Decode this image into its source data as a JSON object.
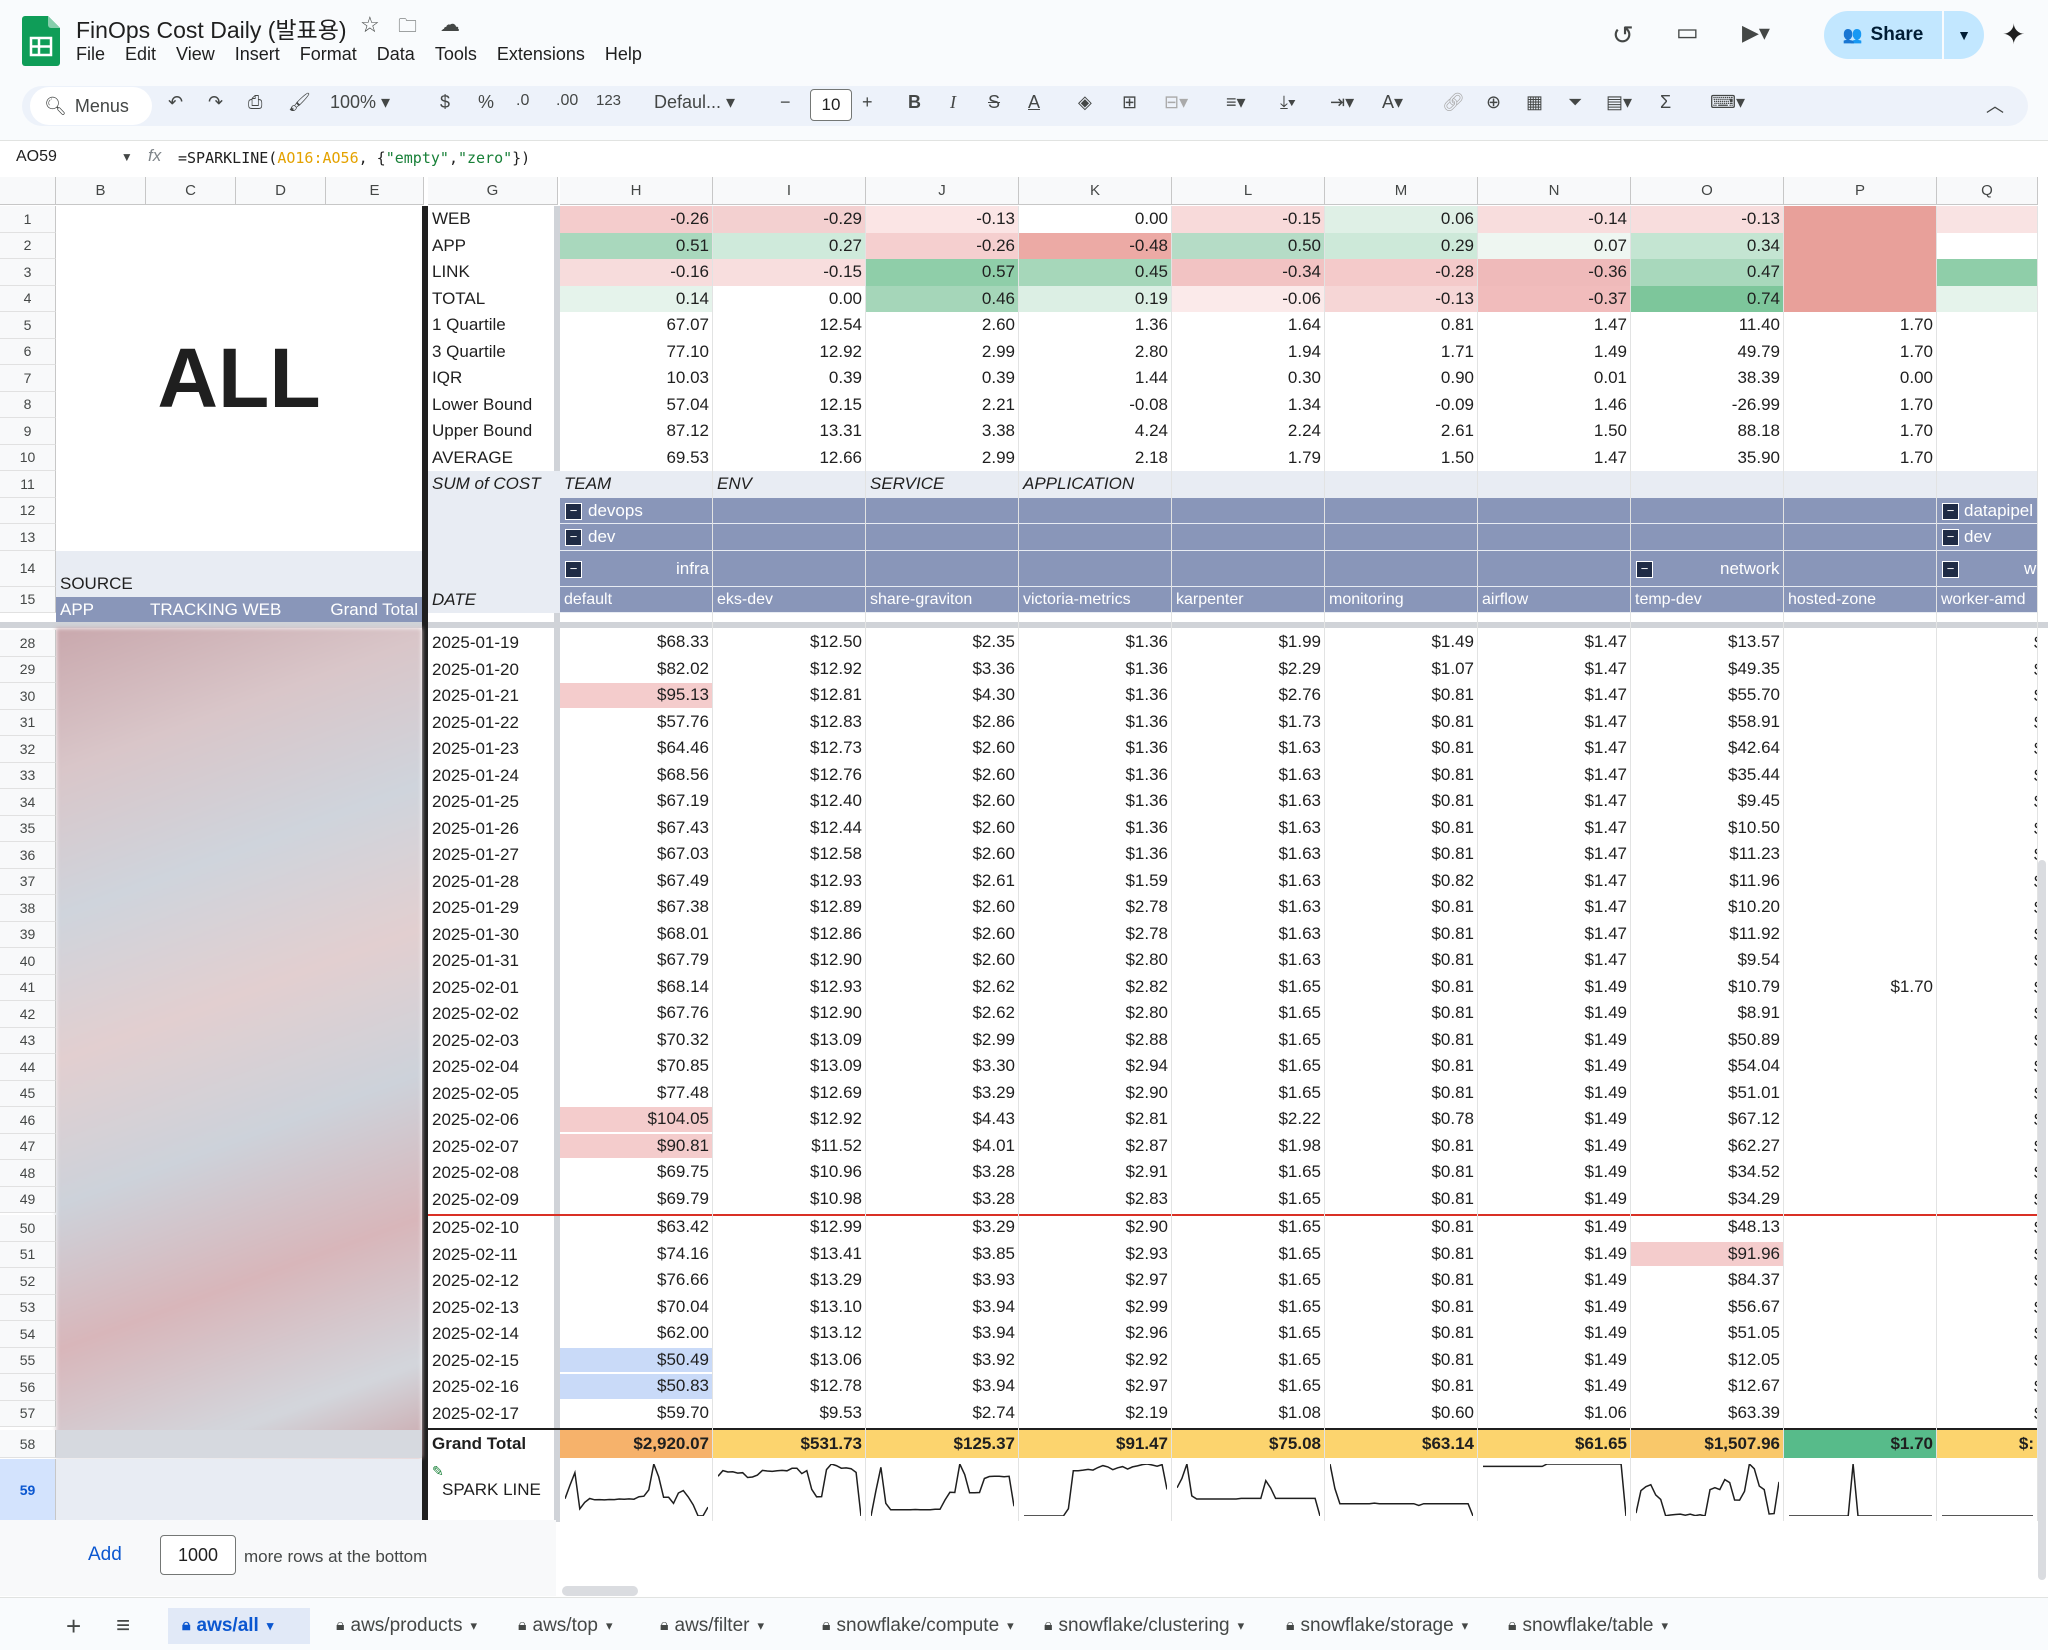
{
  "app": {
    "title": "FinOps Cost Daily (발표용)",
    "share_label": "Share"
  },
  "menu": [
    "File",
    "Edit",
    "View",
    "Insert",
    "Format",
    "Data",
    "Tools",
    "Extensions",
    "Help"
  ],
  "toolbar": {
    "search": "Menus",
    "zoom": "100%",
    "currency": "$",
    "percent": "%",
    "dec_minus": ".0",
    "dec_plus": ".00",
    "format_123": "123",
    "font": "Defaul...",
    "font_size": "10"
  },
  "formula": {
    "cell_ref": "AO59",
    "fx": "fx",
    "prefix": "=SPARKLINE(",
    "range": "AO16:AO56",
    "mid": ", {",
    "s1": "\"empty\"",
    "comma": ",",
    "s2": "\"zero\"",
    "suffix": "})"
  },
  "columns": [
    "B",
    "C",
    "D",
    "E",
    "G",
    "H",
    "I",
    "J",
    "K",
    "L",
    "M",
    "N",
    "O",
    "P",
    "Q"
  ],
  "left_panel": {
    "big_label": "ALL",
    "source": "SOURCE",
    "app": "APP",
    "tracking": "TRACKING WEB",
    "grand_total": "Grand Total"
  },
  "summary_labels": [
    "WEB",
    "APP",
    "LINK",
    "TOTAL",
    "1 Quartile",
    "3 Quartile",
    "IQR",
    "Lower Bound",
    "Upper Bound",
    "AVERAGE"
  ],
  "summary_values": [
    [
      "-0.26",
      "-0.29",
      "-0.13",
      "0.00",
      "-0.15",
      "0.06",
      "-0.14",
      "-0.13",
      ""
    ],
    [
      "0.51",
      "0.27",
      "-0.26",
      "-0.48",
      "0.50",
      "0.29",
      "0.07",
      "0.34",
      ""
    ],
    [
      "-0.16",
      "-0.15",
      "0.57",
      "0.45",
      "-0.34",
      "-0.28",
      "-0.36",
      "0.47",
      ""
    ],
    [
      "0.14",
      "0.00",
      "0.46",
      "0.19",
      "-0.06",
      "-0.13",
      "-0.37",
      "0.74",
      ""
    ],
    [
      "67.07",
      "12.54",
      "2.60",
      "1.36",
      "1.64",
      "0.81",
      "1.47",
      "11.40",
      "1.70"
    ],
    [
      "77.10",
      "12.92",
      "2.99",
      "2.80",
      "1.94",
      "1.71",
      "1.49",
      "49.79",
      "1.70"
    ],
    [
      "10.03",
      "0.39",
      "0.39",
      "1.44",
      "0.30",
      "0.90",
      "0.01",
      "38.39",
      "0.00"
    ],
    [
      "57.04",
      "12.15",
      "2.21",
      "-0.08",
      "1.34",
      "-0.09",
      "1.46",
      "-26.99",
      "1.70"
    ],
    [
      "87.12",
      "13.31",
      "3.38",
      "4.24",
      "2.24",
      "2.61",
      "1.50",
      "88.18",
      "1.70"
    ],
    [
      "69.53",
      "12.66",
      "2.99",
      "2.18",
      "1.79",
      "1.50",
      "1.47",
      "35.90",
      "1.70"
    ]
  ],
  "pivot": {
    "sum_of_cost": "SUM of COST",
    "team": "TEAM",
    "env": "ENV",
    "service": "SERVICE",
    "application": "APPLICATION",
    "devops": "devops",
    "dev": "dev",
    "infra": "infra",
    "network": "network",
    "datapipel": "datapipel",
    "dev2": "dev",
    "w": "w",
    "date": "DATE",
    "apps": [
      "default",
      "eks-dev",
      "share-graviton",
      "victoria-metrics",
      "karpenter",
      "monitoring",
      "airflow",
      "temp-dev",
      "hosted-zone",
      "worker-amd"
    ]
  },
  "rows": [
    {
      "n": "28",
      "d": "2025-01-19",
      "v": [
        "$68.33",
        "$12.50",
        "$2.35",
        "$1.36",
        "$1.99",
        "$1.49",
        "$1.47",
        "$13.57",
        ""
      ]
    },
    {
      "n": "29",
      "d": "2025-01-20",
      "v": [
        "$82.02",
        "$12.92",
        "$3.36",
        "$1.36",
        "$2.29",
        "$1.07",
        "$1.47",
        "$49.35",
        ""
      ]
    },
    {
      "n": "30",
      "d": "2025-01-21",
      "v": [
        "$95.13",
        "$12.81",
        "$4.30",
        "$1.36",
        "$2.76",
        "$0.81",
        "$1.47",
        "$55.70",
        ""
      ]
    },
    {
      "n": "31",
      "d": "2025-01-22",
      "v": [
        "$57.76",
        "$12.83",
        "$2.86",
        "$1.36",
        "$1.73",
        "$0.81",
        "$1.47",
        "$58.91",
        ""
      ]
    },
    {
      "n": "32",
      "d": "2025-01-23",
      "v": [
        "$64.46",
        "$12.73",
        "$2.60",
        "$1.36",
        "$1.63",
        "$0.81",
        "$1.47",
        "$42.64",
        ""
      ]
    },
    {
      "n": "33",
      "d": "2025-01-24",
      "v": [
        "$68.56",
        "$12.76",
        "$2.60",
        "$1.36",
        "$1.63",
        "$0.81",
        "$1.47",
        "$35.44",
        ""
      ]
    },
    {
      "n": "34",
      "d": "2025-01-25",
      "v": [
        "$67.19",
        "$12.40",
        "$2.60",
        "$1.36",
        "$1.63",
        "$0.81",
        "$1.47",
        "$9.45",
        ""
      ]
    },
    {
      "n": "35",
      "d": "2025-01-26",
      "v": [
        "$67.43",
        "$12.44",
        "$2.60",
        "$1.36",
        "$1.63",
        "$0.81",
        "$1.47",
        "$10.50",
        ""
      ]
    },
    {
      "n": "36",
      "d": "2025-01-27",
      "v": [
        "$67.03",
        "$12.58",
        "$2.60",
        "$1.36",
        "$1.63",
        "$0.81",
        "$1.47",
        "$11.23",
        ""
      ]
    },
    {
      "n": "37",
      "d": "2025-01-28",
      "v": [
        "$67.49",
        "$12.93",
        "$2.61",
        "$1.59",
        "$1.63",
        "$0.82",
        "$1.47",
        "$11.96",
        ""
      ]
    },
    {
      "n": "38",
      "d": "2025-01-29",
      "v": [
        "$67.38",
        "$12.89",
        "$2.60",
        "$2.78",
        "$1.63",
        "$0.81",
        "$1.47",
        "$10.20",
        ""
      ]
    },
    {
      "n": "39",
      "d": "2025-01-30",
      "v": [
        "$68.01",
        "$12.86",
        "$2.60",
        "$2.78",
        "$1.63",
        "$0.81",
        "$1.47",
        "$11.92",
        ""
      ]
    },
    {
      "n": "40",
      "d": "2025-01-31",
      "v": [
        "$67.79",
        "$12.90",
        "$2.60",
        "$2.80",
        "$1.63",
        "$0.81",
        "$1.47",
        "$9.54",
        ""
      ]
    },
    {
      "n": "41",
      "d": "2025-02-01",
      "v": [
        "$68.14",
        "$12.93",
        "$2.62",
        "$2.82",
        "$1.65",
        "$0.81",
        "$1.49",
        "$10.79",
        "$1.70"
      ]
    },
    {
      "n": "42",
      "d": "2025-02-02",
      "v": [
        "$67.76",
        "$12.90",
        "$2.62",
        "$2.80",
        "$1.65",
        "$0.81",
        "$1.49",
        "$8.91",
        ""
      ]
    },
    {
      "n": "43",
      "d": "2025-02-03",
      "v": [
        "$70.32",
        "$13.09",
        "$2.99",
        "$2.88",
        "$1.65",
        "$0.81",
        "$1.49",
        "$50.89",
        ""
      ]
    },
    {
      "n": "44",
      "d": "2025-02-04",
      "v": [
        "$70.85",
        "$13.09",
        "$3.30",
        "$2.94",
        "$1.65",
        "$0.81",
        "$1.49",
        "$54.04",
        ""
      ]
    },
    {
      "n": "45",
      "d": "2025-02-05",
      "v": [
        "$77.48",
        "$12.69",
        "$3.29",
        "$2.90",
        "$1.65",
        "$0.81",
        "$1.49",
        "$51.01",
        ""
      ]
    },
    {
      "n": "46",
      "d": "2025-02-06",
      "v": [
        "$104.05",
        "$12.92",
        "$4.43",
        "$2.81",
        "$2.22",
        "$0.78",
        "$1.49",
        "$67.12",
        ""
      ]
    },
    {
      "n": "47",
      "d": "2025-02-07",
      "v": [
        "$90.81",
        "$11.52",
        "$4.01",
        "$2.87",
        "$1.98",
        "$0.81",
        "$1.49",
        "$62.27",
        ""
      ]
    },
    {
      "n": "48",
      "d": "2025-02-08",
      "v": [
        "$69.75",
        "$10.96",
        "$3.28",
        "$2.91",
        "$1.65",
        "$0.81",
        "$1.49",
        "$34.52",
        ""
      ]
    },
    {
      "n": "49",
      "d": "2025-02-09",
      "v": [
        "$69.79",
        "$10.98",
        "$3.28",
        "$2.83",
        "$1.65",
        "$0.81",
        "$1.49",
        "$34.29",
        ""
      ]
    },
    {
      "n": "50",
      "d": "2025-02-10",
      "v": [
        "$63.42",
        "$12.99",
        "$3.29",
        "$2.90",
        "$1.65",
        "$0.81",
        "$1.49",
        "$48.13",
        ""
      ]
    },
    {
      "n": "51",
      "d": "2025-02-11",
      "v": [
        "$74.16",
        "$13.41",
        "$3.85",
        "$2.93",
        "$1.65",
        "$0.81",
        "$1.49",
        "$91.96",
        ""
      ]
    },
    {
      "n": "52",
      "d": "2025-02-12",
      "v": [
        "$76.66",
        "$13.29",
        "$3.93",
        "$2.97",
        "$1.65",
        "$0.81",
        "$1.49",
        "$84.37",
        ""
      ]
    },
    {
      "n": "53",
      "d": "2025-02-13",
      "v": [
        "$70.04",
        "$13.10",
        "$3.94",
        "$2.99",
        "$1.65",
        "$0.81",
        "$1.49",
        "$56.67",
        ""
      ]
    },
    {
      "n": "54",
      "d": "2025-02-14",
      "v": [
        "$62.00",
        "$13.12",
        "$3.94",
        "$2.96",
        "$1.65",
        "$0.81",
        "$1.49",
        "$51.05",
        ""
      ]
    },
    {
      "n": "55",
      "d": "2025-02-15",
      "v": [
        "$50.49",
        "$13.06",
        "$3.92",
        "$2.92",
        "$1.65",
        "$0.81",
        "$1.49",
        "$12.05",
        ""
      ]
    },
    {
      "n": "56",
      "d": "2025-02-16",
      "v": [
        "$50.83",
        "$12.78",
        "$3.94",
        "$2.97",
        "$1.65",
        "$0.81",
        "$1.49",
        "$12.67",
        ""
      ]
    },
    {
      "n": "57",
      "d": "2025-02-17",
      "v": [
        "$59.70",
        "$9.53",
        "$2.74",
        "$2.19",
        "$1.08",
        "$0.60",
        "$1.06",
        "$63.39",
        ""
      ]
    }
  ],
  "grand_total": {
    "label": "Grand Total",
    "n": "58",
    "v": [
      "$2,920.07",
      "$531.73",
      "$125.37",
      "$91.47",
      "$75.08",
      "$63.14",
      "$61.65",
      "$1,507.96",
      "$1.70",
      "$:"
    ]
  },
  "sparkline": {
    "label": "SPARK LINE",
    "n": "59"
  },
  "add_rows": {
    "add": "Add",
    "count": "1000",
    "text": "more rows at the bottom"
  },
  "tabs": [
    "aws/all",
    "aws/products",
    "aws/top",
    "aws/filter",
    "snowflake/compute",
    "snowflake/clustering",
    "snowflake/storage",
    "snowflake/table"
  ],
  "colors": {
    "accent": "#0b57d0",
    "pivot_band": "#8996b9",
    "grand_total": "#fad565",
    "green": "#57bb8a",
    "red": "#e67c73"
  }
}
